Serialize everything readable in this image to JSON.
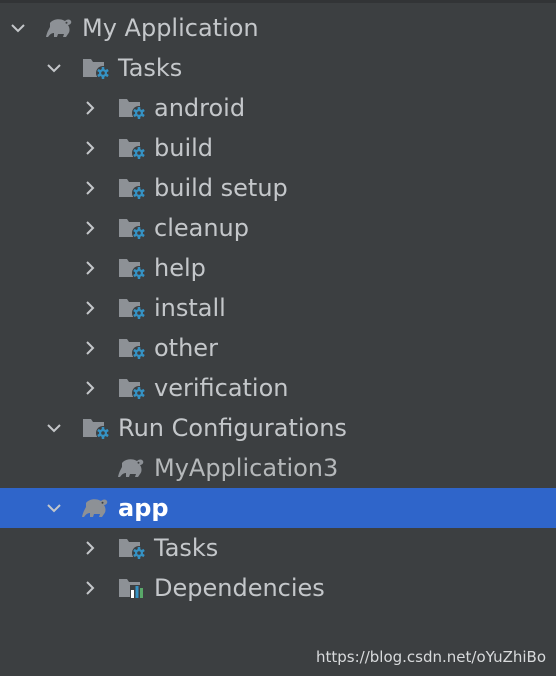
{
  "tree": {
    "root": {
      "label": "My Application",
      "icon": "elephant-icon"
    },
    "tasks_group": {
      "label": "Tasks",
      "icon": "folder-gear-icon",
      "items": [
        {
          "label": "android",
          "icon": "folder-gear-icon"
        },
        {
          "label": "build",
          "icon": "folder-gear-icon"
        },
        {
          "label": "build setup",
          "icon": "folder-gear-icon"
        },
        {
          "label": "cleanup",
          "icon": "folder-gear-icon"
        },
        {
          "label": "help",
          "icon": "folder-gear-icon"
        },
        {
          "label": "install",
          "icon": "folder-gear-icon"
        },
        {
          "label": "other",
          "icon": "folder-gear-icon"
        },
        {
          "label": "verification",
          "icon": "folder-gear-icon"
        }
      ]
    },
    "run_configurations": {
      "label": "Run Configurations",
      "icon": "folder-gear-icon",
      "items": [
        {
          "label": "MyApplication3",
          "icon": "elephant-icon"
        }
      ]
    },
    "app": {
      "label": "app",
      "icon": "elephant-icon",
      "selected": true,
      "items": [
        {
          "label": "Tasks",
          "icon": "folder-gear-icon"
        },
        {
          "label": "Dependencies",
          "icon": "folder-chart-icon"
        }
      ]
    }
  },
  "watermark": "https://blog.csdn.net/oYuZhiBo",
  "colors": {
    "background": "#3c3f41",
    "selection": "#2f65ca",
    "text": "#c4c7ca",
    "folder": "#8d9196",
    "gear": "#3592c4",
    "chart_blue": "#3592c4",
    "chart_green": "#59a869",
    "elephant": "#8d9196"
  }
}
